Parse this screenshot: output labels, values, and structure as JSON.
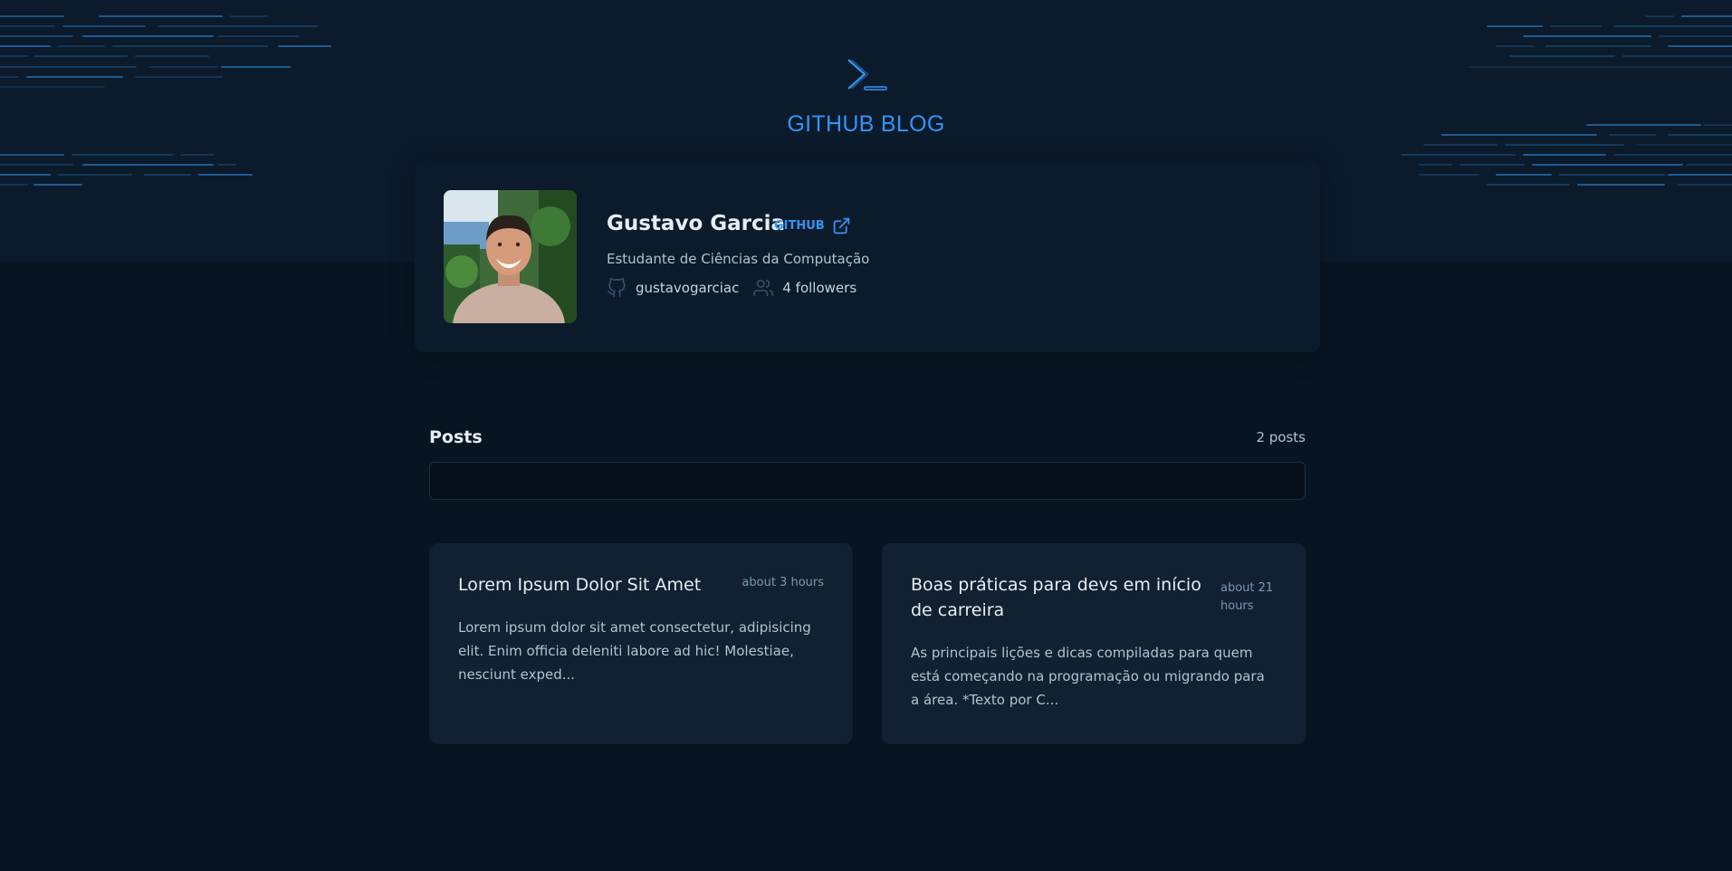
{
  "header": {
    "logo_icon": "terminal-prompt-icon",
    "title": "GITHUB BLOG",
    "accent_color": "#3294F8"
  },
  "profile": {
    "name": "Gustavo Garcia",
    "github_link_label": "GITHUB",
    "github_link_icon": "external-link-icon",
    "bio": "Estudante de Ciências da Computação",
    "username": "gustavogarciac",
    "username_icon": "github-icon",
    "followers": "4 followers",
    "followers_icon": "users-icon"
  },
  "posts": {
    "title": "Posts",
    "count": "2 posts",
    "search_placeholder": "",
    "items": [
      {
        "title": "Lorem Ipsum Dolor Sit Amet",
        "time": "about 3 hours",
        "excerpt": "Lorem ipsum dolor sit amet consectetur, adipisicing elit. Enim officia deleniti labore ad hic! Molestiae, nesciunt exped..."
      },
      {
        "title": "Boas práticas para devs em início de carreira",
        "time": "about 21 hours",
        "excerpt": "As principais lições e dicas compiladas para quem está começando na programação ou migrando para a área. *Texto por C..."
      }
    ]
  },
  "colors": {
    "background": "#071422",
    "header_bg": "#0B1B2B",
    "card_bg": "#112131",
    "title_text": "#E7EDF4",
    "body_text": "#AFC2D4"
  }
}
